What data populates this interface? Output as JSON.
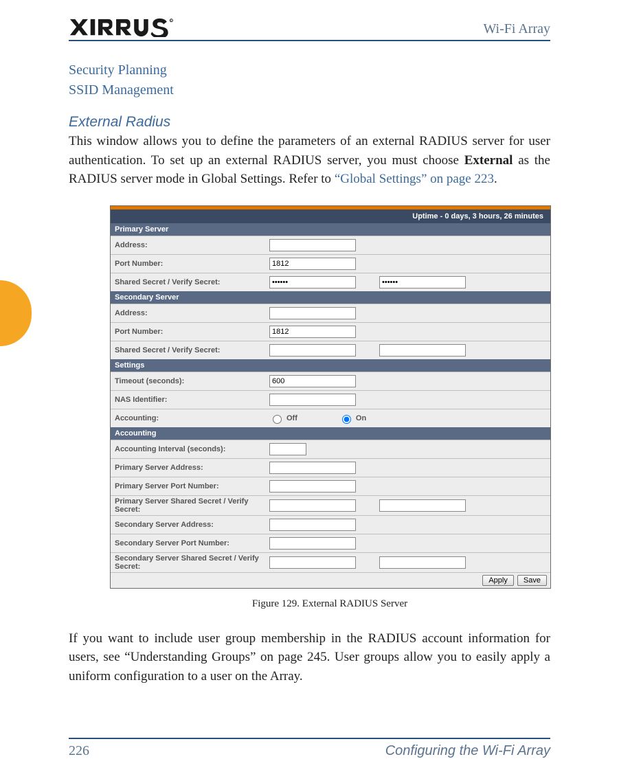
{
  "header": {
    "brand": "XIRRUS",
    "doc_title": "Wi-Fi Array"
  },
  "breadcrumbs": {
    "line1": "Security Planning",
    "line2": "SSID Management"
  },
  "section": {
    "title": "External Radius",
    "para1_a": "This window allows you to define the parameters of an external RADIUS server for user authentication. To set up an external RADIUS server, you must choose ",
    "para1_bold": "External",
    "para1_b": " as the RADIUS server mode in Global Settings. Refer to ",
    "para1_link": "“Global Settings” on page 223",
    "para1_c": "."
  },
  "screenshot": {
    "uptime": "Uptime - 0 days, 3 hours, 26 minutes",
    "sections": {
      "primary": "Primary Server",
      "secondary": "Secondary Server",
      "settings": "Settings",
      "accounting": "Accounting"
    },
    "rows": {
      "p_address": {
        "label": "Address:",
        "value": ""
      },
      "p_port": {
        "label": "Port Number:",
        "value": "1812"
      },
      "p_secret": {
        "label": "Shared Secret / Verify Secret:",
        "v1": "••••••",
        "v2": "••••••"
      },
      "s_address": {
        "label": "Address:",
        "value": ""
      },
      "s_port": {
        "label": "Port Number:",
        "value": "1812"
      },
      "s_secret": {
        "label": "Shared Secret / Verify Secret:",
        "v1": "",
        "v2": ""
      },
      "timeout": {
        "label": "Timeout (seconds):",
        "value": "600"
      },
      "nas": {
        "label": "NAS Identifier:",
        "value": ""
      },
      "acct_toggle": {
        "label": "Accounting:",
        "off": "Off",
        "on": "On",
        "selected": "on"
      },
      "a_interval": {
        "label": "Accounting Interval (seconds):",
        "value": ""
      },
      "a_paddr": {
        "label": "Primary Server Address:",
        "value": ""
      },
      "a_pport": {
        "label": "Primary Server Port Number:",
        "value": ""
      },
      "a_psecret": {
        "label": "Primary Server Shared Secret / Verify Secret:",
        "v1": "",
        "v2": ""
      },
      "a_saddr": {
        "label": "Secondary Server Address:",
        "value": ""
      },
      "a_sport": {
        "label": "Secondary Server Port Number:",
        "value": ""
      },
      "a_ssecret": {
        "label": "Secondary Server Shared Secret / Verify Secret:",
        "v1": "",
        "v2": ""
      }
    },
    "buttons": {
      "apply": "Apply",
      "save": "Save"
    }
  },
  "caption": "Figure 129. External RADIUS Server",
  "para2": {
    "a": "If you want to include user group membership in the RADIUS account information for users, see ",
    "link": "“Understanding Groups” on page 245",
    "b": ". User groups allow you to easily apply a uniform configuration to a user on the Array."
  },
  "footer": {
    "page": "226",
    "section": "Configuring the Wi-Fi Array"
  }
}
